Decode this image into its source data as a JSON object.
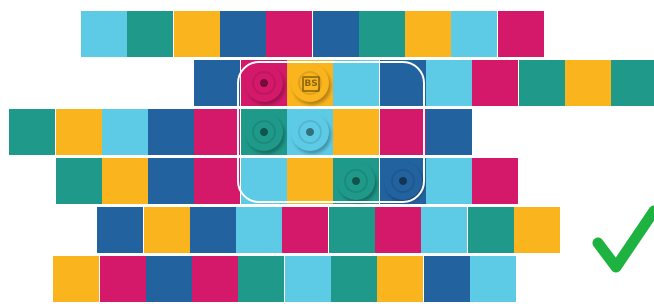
{
  "palette": {
    "cyan": "#5ecbe6",
    "teal": "#1f9a8a",
    "yellow": "#f9b41e",
    "blue": "#22629f",
    "magenta": "#d4196a"
  },
  "rows": [
    {
      "start_col": 1.75,
      "tiles": [
        "cyan",
        "teal",
        "yellow",
        "blue",
        "magenta",
        "blue",
        "teal",
        "yellow",
        "cyan",
        "magenta"
      ]
    },
    {
      "start_col": 4.2,
      "tiles": [
        "blue",
        "magenta",
        "yellow",
        "cyan",
        "blue",
        "cyan",
        "magenta",
        "teal",
        "yellow",
        "teal"
      ]
    },
    {
      "start_col": 0.2,
      "tiles": [
        "teal",
        "yellow",
        "cyan",
        "blue",
        "magenta",
        "teal",
        "cyan",
        "yellow",
        "magenta",
        "blue"
      ]
    },
    {
      "start_col": 1.2,
      "tiles": [
        "teal",
        "yellow",
        "blue",
        "magenta",
        "cyan",
        "yellow",
        "teal",
        "blue",
        "cyan",
        "magenta"
      ]
    },
    {
      "start_col": 2.1,
      "tiles": [
        "blue",
        "yellow",
        "blue",
        "cyan",
        "magenta",
        "teal",
        "magenta",
        "cyan",
        "teal",
        "yellow"
      ]
    },
    {
      "start_col": 1.15,
      "tiles": [
        "yellow",
        "magenta",
        "blue",
        "magenta",
        "teal",
        "cyan",
        "teal",
        "yellow",
        "blue",
        "cyan"
      ]
    }
  ],
  "tokens": [
    {
      "row": 1,
      "index": 1,
      "color": "magenta",
      "glyph": ""
    },
    {
      "row": 1,
      "index": 2,
      "color": "yellow",
      "glyph": "BS"
    },
    {
      "row": 2,
      "index": 5,
      "color": "teal",
      "glyph": ""
    },
    {
      "row": 2,
      "index": 6,
      "color": "cyan",
      "glyph": ""
    },
    {
      "row": 3,
      "index": 6,
      "color": "teal",
      "glyph": ""
    },
    {
      "row": 3,
      "index": 7,
      "color": "blue",
      "glyph": ""
    }
  ],
  "selection": {
    "rows": [
      1,
      3
    ]
  },
  "status": {
    "solved": true,
    "check_color": "#1eb340"
  }
}
